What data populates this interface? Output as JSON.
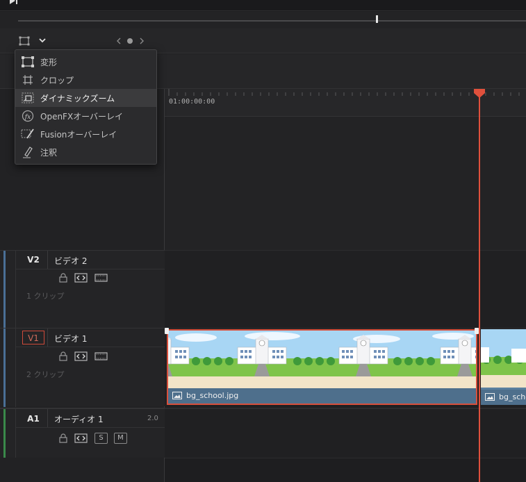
{
  "toolbar": {
    "mode_icon": "transform-mode-icon",
    "colors": {
      "accent": "#e0503c",
      "clip": "#5a7f9e"
    }
  },
  "menu": {
    "items": [
      {
        "label": "変形",
        "icon": "transform-icon"
      },
      {
        "label": "クロップ",
        "icon": "crop-icon"
      },
      {
        "label": "ダイナミックズーム",
        "icon": "dynamic-zoom-icon",
        "active": true
      },
      {
        "label": "OpenFXオーバーレイ",
        "icon": "fx-icon"
      },
      {
        "label": "Fusionオーバーレイ",
        "icon": "fusion-brush-icon"
      },
      {
        "label": "注釈",
        "icon": "annotation-pen-icon"
      }
    ]
  },
  "timeline": {
    "timecode": "01:00:00:00"
  },
  "tracks": {
    "v2": {
      "code": "V2",
      "name": "ビデオ 2",
      "clips": "1 クリップ"
    },
    "v1": {
      "code": "V1",
      "name": "ビデオ 1",
      "clips": "2 クリップ"
    },
    "a1": {
      "code": "A1",
      "name": "オーディオ 1",
      "level": "2.0",
      "solo": "S",
      "mute": "M"
    }
  },
  "clips": [
    {
      "name": "bg_school.jpg"
    },
    {
      "name": "bg_scho"
    }
  ]
}
